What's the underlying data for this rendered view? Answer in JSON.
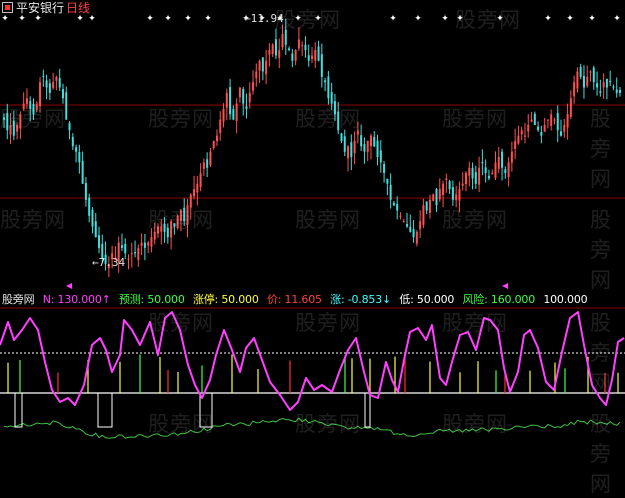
{
  "header": {
    "stock_name": "平安银行",
    "period": "日线"
  },
  "main_chart": {
    "high_label": "11.94",
    "low_label": "7.34"
  },
  "indicator_bar": {
    "name": "股旁网",
    "params": [
      {
        "label": "N: 130.000↑",
        "color": "#ff40ff"
      },
      {
        "label": "预测: 50.000",
        "color": "#40ff40"
      },
      {
        "label": "涨停: 50.000",
        "color": "#ffff40"
      },
      {
        "label": "价: 11.605",
        "color": "#ff4040"
      },
      {
        "label": "涨: -0.853↓",
        "color": "#40ffff"
      },
      {
        "label": "低: 50.000",
        "color": "#ffffff"
      },
      {
        "label": "风险: 160.000",
        "color": "#40ff40"
      },
      {
        "label": "100.000",
        "color": "#ffffff"
      }
    ]
  },
  "watermark": "股旁网",
  "colors": {
    "up_candle": "#ff5050",
    "down_candle": "#40e0e0",
    "grid": "#8b0000",
    "magenta_line": "#ff40ff",
    "green_line": "#40c040",
    "white_line": "#ffffff",
    "yellow_bar": "#ffff40",
    "red_bar": "#ff3030",
    "green_bar": "#40ff40",
    "marker": "#ffffff"
  },
  "chart_data": {
    "type": "line",
    "price_range": [
      7.34,
      11.94
    ],
    "closes": [
      10.2,
      10.0,
      10.1,
      9.9,
      10.1,
      10.3,
      10.5,
      10.6,
      10.4,
      10.3,
      10.5,
      10.9,
      11.0,
      10.8,
      10.7,
      10.9,
      11.0,
      10.8,
      10.6,
      10.2,
      10.0,
      9.7,
      9.6,
      9.4,
      9.0,
      8.7,
      8.4,
      8.2,
      8.0,
      7.8,
      7.6,
      7.5,
      7.5,
      7.7,
      7.6,
      7.9,
      7.8,
      7.7,
      7.6,
      7.7,
      7.7,
      7.8,
      7.9,
      7.8,
      7.9,
      8.0,
      8.1,
      8.2,
      8.2,
      8.1,
      8.0,
      8.3,
      8.2,
      8.4,
      8.5,
      8.3,
      8.6,
      8.8,
      8.9,
      9.0,
      9.2,
      9.4,
      9.3,
      9.6,
      9.8,
      9.9,
      10.2,
      10.4,
      10.7,
      10.3,
      10.2,
      10.5,
      10.8,
      10.5,
      10.4,
      10.7,
      10.9,
      11.1,
      11.3,
      11.1,
      11.3,
      11.5,
      11.6,
      11.4,
      11.5,
      11.8,
      11.6,
      11.5,
      11.3,
      11.5,
      11.7,
      11.6,
      11.5,
      11.3,
      11.4,
      11.5,
      11.3,
      11.0,
      10.9,
      10.6,
      10.5,
      10.3,
      10.0,
      9.8,
      9.6,
      9.7,
      9.5,
      9.8,
      10.0,
      9.7,
      9.6,
      9.8,
      9.9,
      9.7,
      9.5,
      9.4,
      9.2,
      9.0,
      8.7,
      8.6,
      8.5,
      8.4,
      8.3,
      8.2,
      8.1,
      8.0,
      8.1,
      8.3,
      8.6,
      8.5,
      8.7,
      8.8,
      8.6,
      8.9,
      9.0,
      9.1,
      8.9,
      8.7,
      8.8,
      8.9,
      9.0,
      9.2,
      9.3,
      9.1,
      9.0,
      9.3,
      9.4,
      9.2,
      9.1,
      9.2,
      9.4,
      9.5,
      9.3,
      9.2,
      9.4,
      9.6,
      9.8,
      9.9,
      10.0,
      9.9,
      10.1,
      10.2,
      10.1,
      10.0,
      9.9,
      10.1,
      10.2,
      10.3,
      10.2,
      10.0,
      9.9,
      10.1,
      10.3,
      10.6,
      10.9,
      11.1,
      11.0,
      10.8,
      11.0,
      11.1,
      10.9,
      10.8,
      10.7,
      10.9,
      10.8,
      10.9,
      10.8,
      10.7,
      10.7
    ]
  }
}
